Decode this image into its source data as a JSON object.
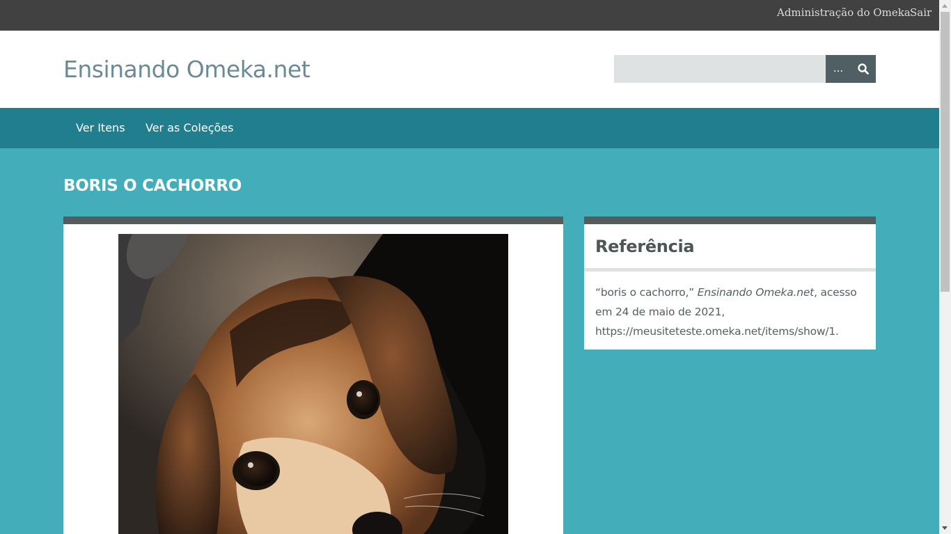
{
  "admin_bar": {
    "admin_link": "Administração do Omeka",
    "logout_link": "Sair"
  },
  "header": {
    "site_title": "Ensinando Omeka.net",
    "search": {
      "placeholder": "",
      "value": "",
      "options_label": "...",
      "submit_icon": "search-icon"
    }
  },
  "nav": {
    "items": [
      {
        "label": "Ver Itens"
      },
      {
        "label": "Ver as Coleções"
      }
    ]
  },
  "item": {
    "title": "BORIS O CACHORRO",
    "image_alt": "boris o cachorro"
  },
  "sidebar": {
    "heading": "Referência",
    "citation": {
      "prefix": "“boris o cachorro,” ",
      "site": "Ensinando Omeka.net",
      "suffix": ", acesso em 24 de maio de 2021, https://meusiteteste.omeka.net/items/show/1."
    }
  },
  "colors": {
    "admin_bar": "#414141",
    "nav": "#217e8e",
    "background": "#43adb9",
    "site_title": "#6b8a96",
    "panel_border": "#545c5d"
  }
}
